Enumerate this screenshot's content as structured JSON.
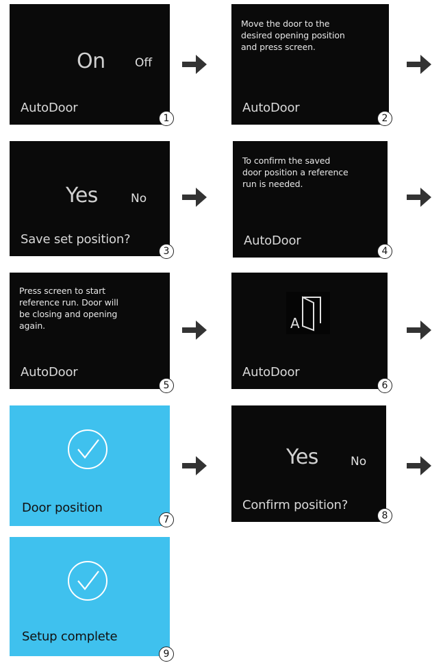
{
  "steps": [
    {
      "num": "1",
      "big": "On",
      "small": "Off",
      "bottom": "AutoDoor"
    },
    {
      "num": "2",
      "message": [
        "Move the door to the",
        "desired opening position",
        "and press screen."
      ],
      "bottom": "AutoDoor"
    },
    {
      "num": "3",
      "big": "Yes",
      "small": "No",
      "bottom": "Save set position?"
    },
    {
      "num": "4",
      "message": [
        "To confirm the saved",
        "door position a reference",
        "run is needed."
      ],
      "bottom": "AutoDoor"
    },
    {
      "num": "5",
      "message": [
        "Press screen to start",
        "reference run. Door will",
        "be closing and opening",
        "again."
      ],
      "bottom": "AutoDoor"
    },
    {
      "num": "6",
      "icon_letter": "A",
      "icon": "door-icon",
      "bottom": "AutoDoor"
    },
    {
      "num": "7",
      "icon": "checkmark-circle-icon",
      "bottom": "Door position"
    },
    {
      "num": "8",
      "big": "Yes",
      "small": "No",
      "bottom": "Confirm position?"
    },
    {
      "num": "9",
      "icon": "checkmark-circle-icon",
      "bottom": "Setup complete"
    }
  ],
  "colors": {
    "screen": "#0a0a0a",
    "success": "#3fc1ee",
    "arrow": "#333333"
  }
}
